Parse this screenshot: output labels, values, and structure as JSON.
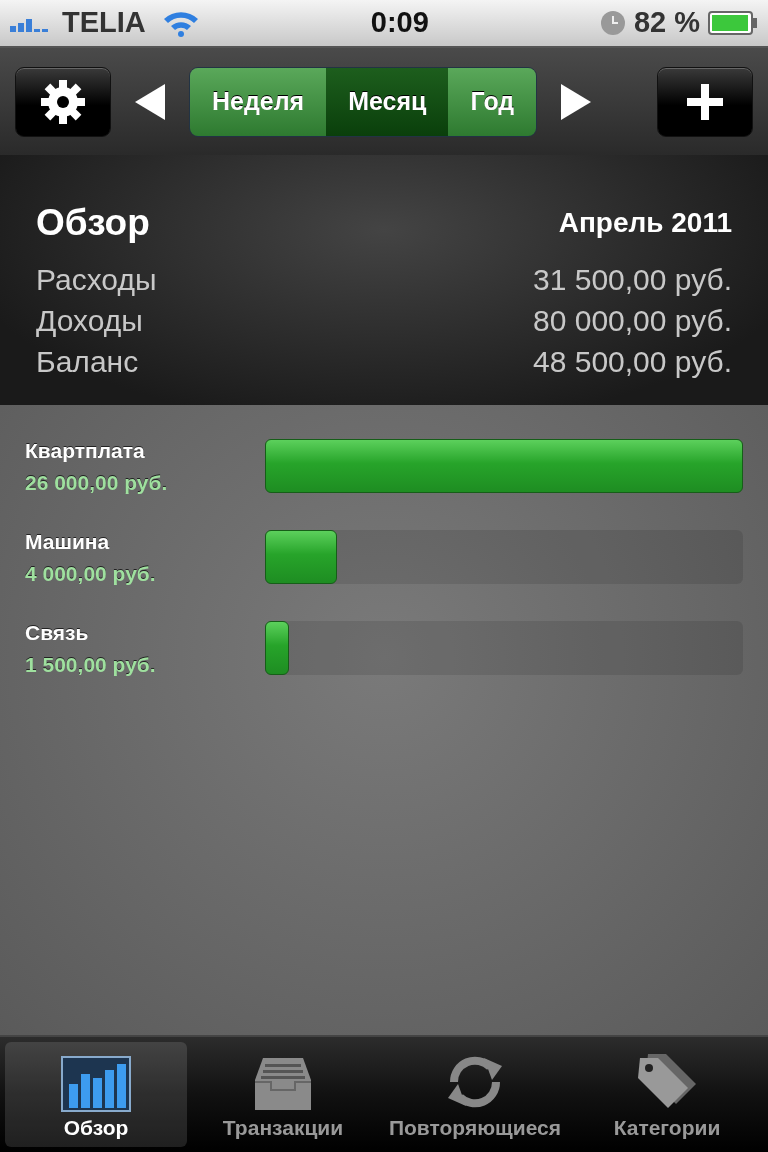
{
  "status_bar": {
    "carrier": "TELIA",
    "time": "0:09",
    "battery_percent": "82 %"
  },
  "toolbar": {
    "periods": [
      {
        "label": "Неделя",
        "selected": false
      },
      {
        "label": "Месяц",
        "selected": true
      },
      {
        "label": "Год",
        "selected": false
      }
    ]
  },
  "summary": {
    "title": "Обзор",
    "period": "Апрель 2011",
    "rows": [
      {
        "label": "Расходы",
        "value": "31 500,00 руб."
      },
      {
        "label": "Доходы",
        "value": "80 000,00 руб."
      },
      {
        "label": "Баланс",
        "value": "48 500,00 руб."
      }
    ]
  },
  "categories": [
    {
      "name": "Квартплата",
      "amount": "26 000,00 руб.",
      "level": 1
    },
    {
      "name": "Машина",
      "amount": "4 000,00 руб.",
      "level": 0.15
    },
    {
      "name": "Связь",
      "amount": "1 500,00 руб.",
      "level": 0.05
    }
  ],
  "tab_bar": [
    {
      "label": "Обзор",
      "selected": true
    },
    {
      "label": "Транзакции",
      "selected": false
    },
    {
      "label": "Повторяющиеся",
      "selected": false
    },
    {
      "label": "Категории",
      "selected": false
    }
  ]
}
